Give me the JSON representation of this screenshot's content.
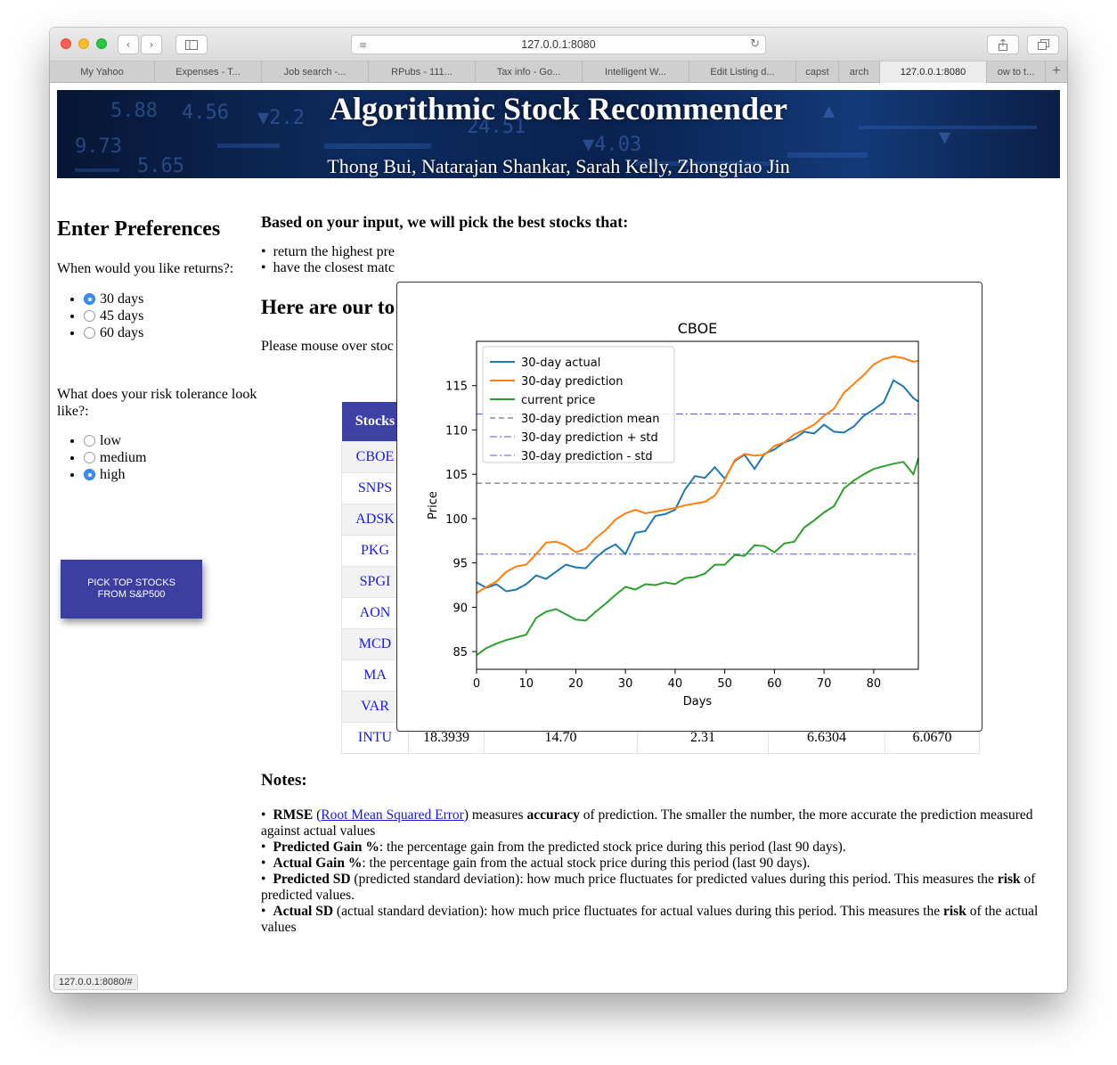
{
  "browser": {
    "url": "127.0.0.1:8080",
    "tabs": [
      "My Yahoo",
      "Expenses - T...",
      "Job search -...",
      "RPubs - 111...",
      "Tax info - Go...",
      "Intelligent W...",
      "Edit Listing d...",
      "capst",
      "arch",
      "127.0.0.1:8080",
      "ow to t..."
    ],
    "status": "127.0.0.1:8080/#"
  },
  "banner": {
    "title": "Algorithmic Stock Recommender",
    "authors": "Thong Bui, Natarajan Shankar, Sarah Kelly, Zhongqiao Jin"
  },
  "prefs": {
    "title": "Enter Preferences",
    "returns_question": "When would you like returns?:",
    "returns_options": [
      "30 days",
      "45 days",
      "60 days"
    ],
    "returns_selected": "30 days",
    "risk_question": "What does your risk tolerance look like?:",
    "risk_options": [
      "low",
      "medium",
      "high"
    ],
    "risk_selected": "high",
    "button_line1": "PICK TOP STOCKS",
    "button_line2": "FROM S&P500"
  },
  "main": {
    "heading": "Based on your input, we will pick the best stocks that:",
    "criteria": [
      "return the highest pre",
      "have the closest matc"
    ],
    "results_heading": "Here are our to",
    "mouse_note": "Please mouse over stoc",
    "table_header": "Stocks",
    "tickers": [
      "CBOE",
      "SNPS",
      "ADSK",
      "PKG",
      "SPGI",
      "AON",
      "MCD",
      "MA",
      "VAR",
      "INTU"
    ],
    "last_row": [
      "18.3939",
      "14.70",
      "2.31",
      "6.6304",
      "6.0670"
    ]
  },
  "notes": {
    "title": "Notes:",
    "items": [
      {
        "bold": "RMSE",
        "pre": " (",
        "link": "Root Mean Squared Error",
        "mid": ") measures ",
        "bold2": "accuracy",
        "post": " of prediction. The smaller the number, the more accurate the prediction measured against actual values"
      },
      {
        "bold": "Predicted Gain %",
        "post": ": the percentage gain from the predicted stock price during this period (last 90 days)."
      },
      {
        "bold": "Actual Gain %",
        "post": ": the percentage gain from the actual stock price during this period (last 90 days)."
      },
      {
        "bold": "Predicted SD",
        "post": " (predicted standard deviation): how much price fluctuates for predicted values during this period. This measures the ",
        "bold2": "risk",
        "post2": " of predicted values."
      },
      {
        "bold": "Actual SD",
        "post": " (actual standard deviation): how much price fluctuates for actual values during this period. This measures the ",
        "bold2": "risk",
        "post2": " of the actual values"
      }
    ]
  },
  "chart_data": {
    "type": "line",
    "title": "CBOE",
    "xlabel": "Days",
    "ylabel": "Price",
    "xlim": [
      0,
      89
    ],
    "ylim": [
      83,
      120
    ],
    "xticks": [
      0,
      10,
      20,
      30,
      40,
      50,
      60,
      70,
      80
    ],
    "yticks": [
      85,
      90,
      95,
      100,
      105,
      110,
      115
    ],
    "legend_position": "top-left",
    "colors": {
      "actual": "#1f77b4",
      "prediction": "#ff7f0e",
      "current": "#2ca02c",
      "mean": "#555555",
      "std": "#5a5ac8"
    },
    "series": [
      {
        "name": "30-day actual",
        "x": [
          0,
          2,
          4,
          6,
          8,
          10,
          12,
          14,
          16,
          18,
          20,
          22,
          24,
          26,
          28,
          30,
          32,
          34,
          36,
          38,
          40,
          42,
          44,
          46,
          48,
          50,
          52,
          54,
          56,
          58,
          60,
          62,
          64,
          66,
          68,
          70,
          72,
          74,
          76,
          78,
          80,
          82,
          84,
          86,
          88,
          89
        ],
        "values": [
          92.8,
          92.2,
          92.6,
          91.8,
          92.0,
          92.6,
          93.6,
          93.2,
          94.0,
          94.8,
          94.5,
          94.4,
          95.6,
          96.5,
          97.1,
          96.0,
          98.4,
          98.6,
          100.3,
          100.5,
          101.0,
          103.3,
          104.8,
          104.6,
          105.8,
          104.5,
          106.5,
          107.2,
          105.6,
          107.3,
          107.8,
          108.6,
          109.0,
          109.8,
          109.6,
          110.6,
          109.8,
          109.7,
          110.4,
          111.6,
          112.3,
          113.1,
          115.6,
          114.9,
          113.6,
          113.2
        ]
      },
      {
        "name": "30-day prediction",
        "x": [
          0,
          2,
          4,
          6,
          8,
          10,
          12,
          14,
          16,
          18,
          20,
          22,
          24,
          26,
          28,
          30,
          32,
          34,
          36,
          38,
          40,
          42,
          44,
          46,
          48,
          50,
          52,
          54,
          56,
          58,
          60,
          62,
          64,
          66,
          68,
          70,
          72,
          74,
          76,
          78,
          80,
          82,
          84,
          86,
          88,
          89
        ],
        "values": [
          91.6,
          92.3,
          92.9,
          94.0,
          94.6,
          94.8,
          96.0,
          97.3,
          97.4,
          97.0,
          96.2,
          96.6,
          97.8,
          98.7,
          99.9,
          100.6,
          101.0,
          100.6,
          100.8,
          101.0,
          101.2,
          101.5,
          101.7,
          101.9,
          102.6,
          104.4,
          106.6,
          107.3,
          107.1,
          107.2,
          108.2,
          108.6,
          109.5,
          110.0,
          110.6,
          111.6,
          112.4,
          114.2,
          115.2,
          116.2,
          117.4,
          118.0,
          118.3,
          118.1,
          117.7,
          117.8
        ]
      },
      {
        "name": "current price",
        "x": [
          0,
          2,
          4,
          6,
          8,
          10,
          12,
          14,
          16,
          18,
          20,
          22,
          24,
          26,
          28,
          30,
          32,
          34,
          36,
          38,
          40,
          42,
          44,
          46,
          48,
          50,
          52,
          54,
          56,
          58,
          60,
          62,
          64,
          66,
          68,
          70,
          72,
          74,
          76,
          78,
          80,
          82,
          84,
          86,
          88,
          89
        ],
        "values": [
          84.6,
          85.4,
          85.9,
          86.3,
          86.6,
          86.9,
          88.8,
          89.5,
          89.8,
          89.2,
          88.6,
          88.5,
          89.5,
          90.4,
          91.4,
          92.3,
          92.0,
          92.6,
          92.5,
          92.8,
          92.6,
          93.3,
          93.4,
          93.8,
          94.8,
          94.8,
          95.9,
          95.8,
          97.0,
          96.9,
          96.2,
          97.2,
          97.4,
          99.0,
          99.8,
          100.7,
          101.4,
          103.4,
          104.3,
          105.0,
          105.6,
          105.9,
          106.2,
          106.4,
          105.0,
          106.8
        ]
      },
      {
        "name": "30-day prediction mean",
        "value": 104.0
      },
      {
        "name": "30-day prediction + std",
        "value": 111.8
      },
      {
        "name": "30-day prediction - std",
        "value": 96.0
      }
    ]
  }
}
